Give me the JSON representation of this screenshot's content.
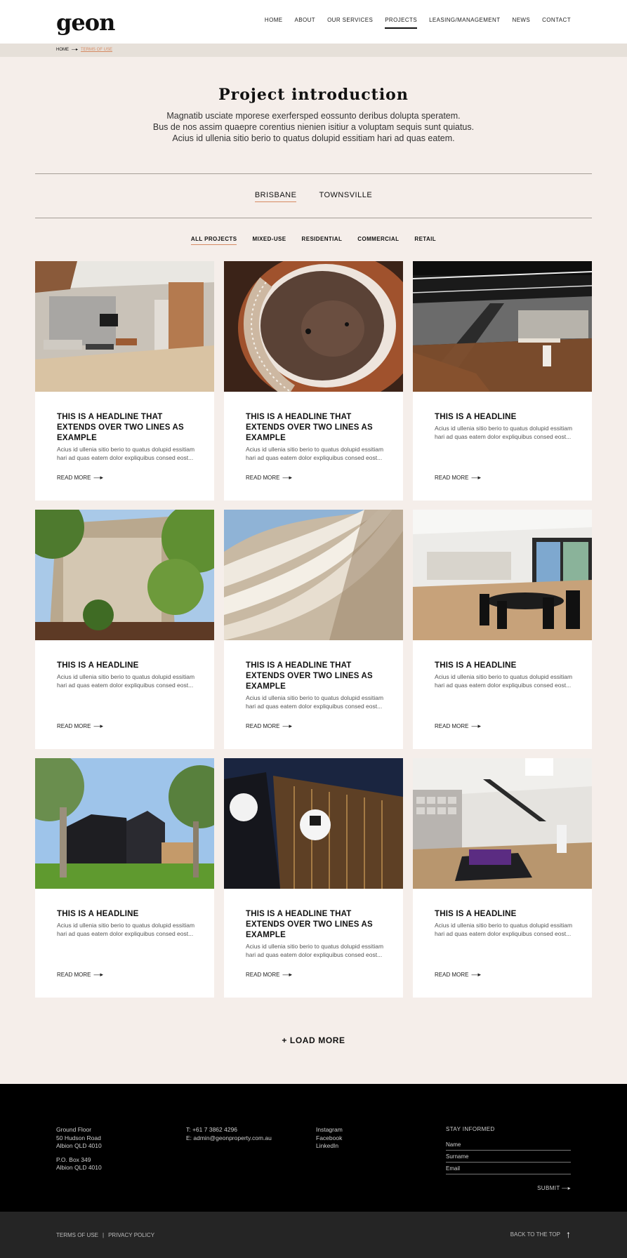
{
  "header": {
    "logo": "geon",
    "nav": [
      {
        "label": "HOME",
        "active": false
      },
      {
        "label": "ABOUT",
        "active": false
      },
      {
        "label": "OUR SERVICES",
        "active": false
      },
      {
        "label": "PROJECTS",
        "active": true
      },
      {
        "label": "LEASING/MANAGEMENT",
        "active": false
      },
      {
        "label": "NEWS",
        "active": false
      },
      {
        "label": "CONTACT",
        "active": false
      }
    ]
  },
  "breadcrumb": {
    "home": "HOME",
    "arrow": "—▸",
    "current": "TERMS OF USE"
  },
  "intro": {
    "title": "Project introduction",
    "lines": [
      "Magnatib usciate mporese exerfersped eossunto deribus dolupta speratem.",
      "Bus de nos assim quaepre corentius nienien isitiur a voluptam sequis sunt quiatus.",
      "Acius id ullenia sitio berio to quatus dolupid essitiam hari ad quas eatem."
    ]
  },
  "cities": [
    {
      "label": "BRISBANE",
      "active": true
    },
    {
      "label": "TOWNSVILLE",
      "active": false
    }
  ],
  "filters": [
    {
      "label": "ALL PROJECTS",
      "active": true
    },
    {
      "label": "MIXED-USE",
      "active": false
    },
    {
      "label": "RESIDENTIAL",
      "active": false
    },
    {
      "label": "COMMERCIAL",
      "active": false
    },
    {
      "label": "RETAIL",
      "active": false
    }
  ],
  "cards": [
    {
      "headline": "THIS IS A HEADLINE THAT EXTENDS OVER TWO LINES AS EXAMPLE",
      "excerpt": "Acius id ullenia sitio berio to quatus dolupid essitiam hari ad quas eatem dolor expliquibus consed eost...",
      "more": "READ MORE",
      "image": "lobby-interior"
    },
    {
      "headline": "THIS IS A HEADLINE THAT EXTENDS OVER TWO LINES AS EXAMPLE",
      "excerpt": "Acius id ullenia sitio berio to quatus dolupid essitiam hari ad quas eatem dolor expliquibus consed eost...",
      "more": "READ MORE",
      "image": "spiral-stair"
    },
    {
      "headline": "THIS IS A HEADLINE",
      "excerpt": "Acius id ullenia sitio berio to quatus dolupid essitiam hari ad quas eatem dolor expliquibus consed eost...",
      "more": "READ MORE",
      "image": "office-stairs"
    },
    {
      "headline": "THIS IS A HEADLINE",
      "excerpt": "Acius id ullenia sitio berio to quatus dolupid essitiam hari ad quas eatem dolor expliquibus consed eost...",
      "more": "READ MORE",
      "image": "facade-trees"
    },
    {
      "headline": "THIS IS A HEADLINE THAT EXTENDS OVER TWO LINES AS EXAMPLE",
      "excerpt": "Acius id ullenia sitio berio to quatus dolupid essitiam hari ad quas eatem dolor expliquibus consed eost...",
      "more": "READ MORE",
      "image": "curved-balconies"
    },
    {
      "headline": "THIS IS A HEADLINE",
      "excerpt": "Acius id ullenia sitio berio to quatus dolupid essitiam hari ad quas eatem dolor expliquibus consed eost...",
      "more": "READ MORE",
      "image": "dining-room"
    },
    {
      "headline": "THIS IS A HEADLINE",
      "excerpt": "Acius id ullenia sitio berio to quatus dolupid essitiam hari ad quas eatem dolor expliquibus consed eost...",
      "more": "READ MORE",
      "image": "building-lawn"
    },
    {
      "headline": "THIS IS A HEADLINE THAT EXTENDS OVER TWO LINES AS EXAMPLE",
      "excerpt": "Acius id ullenia sitio berio to quatus dolupid essitiam hari ad quas eatem dolor expliquibus consed eost...",
      "more": "READ MORE",
      "image": "deakin-night"
    },
    {
      "headline": "THIS IS A HEADLINE",
      "excerpt": "Acius id ullenia sitio berio to quatus dolupid essitiam hari ad quas eatem dolor expliquibus consed eost...",
      "more": "READ MORE",
      "image": "office-lounge"
    }
  ],
  "load_more": "+ LOAD MORE",
  "footer": {
    "address": [
      "Ground Floor",
      "50 Hudson Road",
      "Albion QLD 4010"
    ],
    "po_box": [
      "P.O. Box 349",
      "Albion QLD 4010"
    ],
    "contact": [
      "T: +61 7 3862 4296",
      "E: admin@geonproperty.com.au"
    ],
    "social": [
      "Instagram",
      "Facebook",
      "LinkedIn"
    ],
    "newsletter": {
      "title": "STAY INFORMED",
      "fields": [
        "Name",
        "Surname",
        "Email"
      ],
      "submit": "SUBMIT"
    },
    "legal": {
      "terms": "TERMS OF USE",
      "separator": "|",
      "privacy": "PRIVACY POLICY"
    },
    "back_to_top": "BACK TO THE TOP"
  },
  "colors": {
    "accent": "#d68a63",
    "page_bg": "#f5eeea",
    "footer_bg": "#000000",
    "bottom_bar_bg": "#252525"
  }
}
